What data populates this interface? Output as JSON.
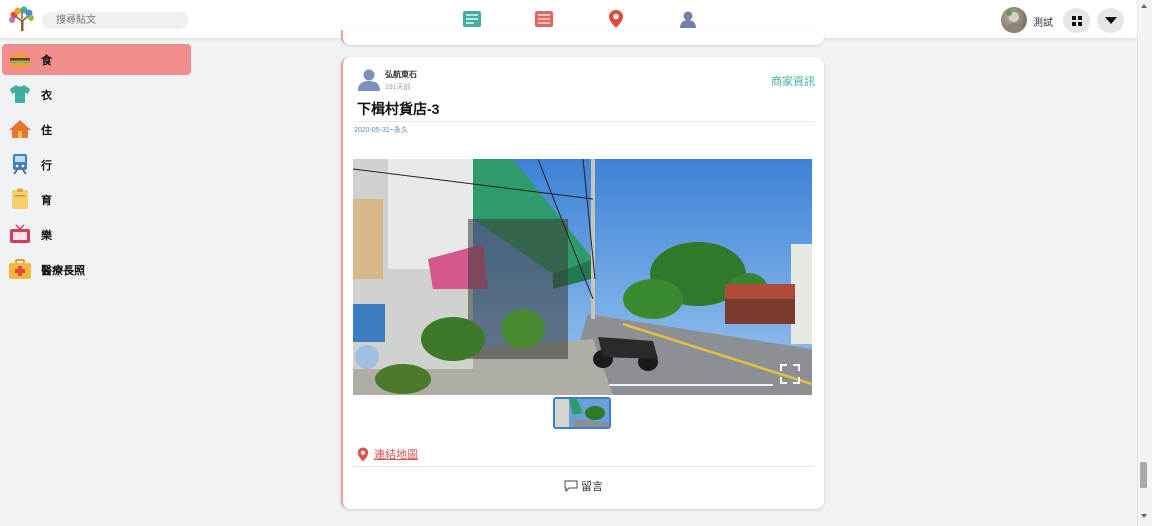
{
  "header": {
    "search_placeholder": "搜尋貼文",
    "user_name": "測試",
    "nav_tabs": [
      {
        "name": "tab-posts",
        "active": true,
        "color": "#3fae9e"
      },
      {
        "name": "tab-list",
        "active": false,
        "color": "#e7675f"
      },
      {
        "name": "tab-map",
        "active": false,
        "color": "#e24a3e"
      },
      {
        "name": "tab-people",
        "active": false,
        "color": "#6f7fa8"
      }
    ]
  },
  "sidebar": {
    "items": [
      {
        "label": "食",
        "icon": "burger-icon",
        "active": true
      },
      {
        "label": "衣",
        "icon": "shirt-icon",
        "active": false
      },
      {
        "label": "住",
        "icon": "house-icon",
        "active": false
      },
      {
        "label": "行",
        "icon": "train-icon",
        "active": false
      },
      {
        "label": "育",
        "icon": "clipboard-icon",
        "active": false
      },
      {
        "label": "樂",
        "icon": "tv-icon",
        "active": false
      },
      {
        "label": "醫療長照",
        "icon": "medical-kit-icon",
        "active": false
      }
    ]
  },
  "post": {
    "author": "弘航東石",
    "time_ago": "191天前",
    "category_tag": "商家資訊",
    "title": "下楫村貨店-3",
    "date_range": "2020-05-31~永久",
    "map_link": "連結地圖",
    "comment_label": "留言"
  },
  "colors": {
    "accent": "#3fae9e",
    "sidebar_active": "#f08e8c",
    "link_red": "#d9534f",
    "card_border": "#e8a29b"
  }
}
